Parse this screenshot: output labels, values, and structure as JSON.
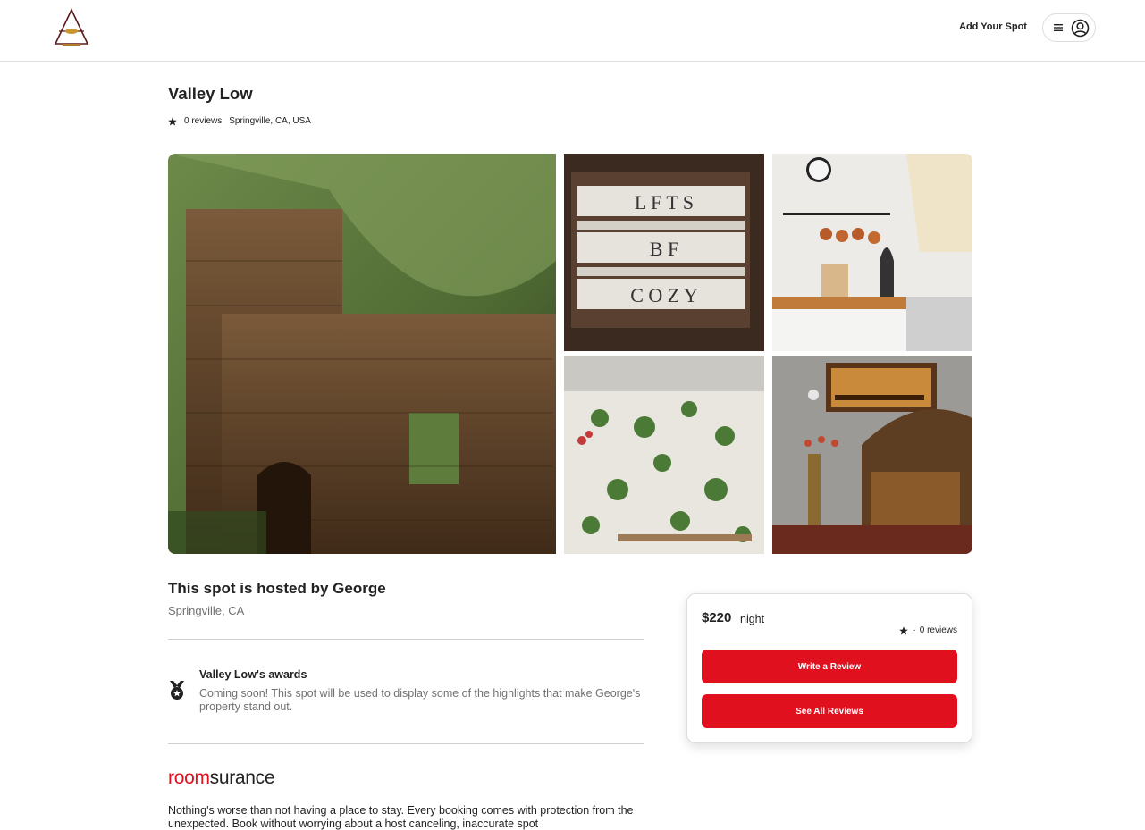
{
  "header": {
    "logo_icon": "triangle-lamp-logo",
    "add_spot_label": "Add Your Spot",
    "menu_icon": "hamburger-menu-icon",
    "profile_icon": "user-circle-icon"
  },
  "spot": {
    "title": "Valley Low",
    "reviews_label": "0 reviews",
    "location": "Springville, CA, USA"
  },
  "gallery": {
    "images": [
      {
        "icon": "stone-ruin-photo",
        "alt": "Stone ruins on a green hillside"
      },
      {
        "icon": "letter-board-photo",
        "alt": "Letter board"
      },
      {
        "icon": "kitchen-photo",
        "alt": "Kitchen with copper pots"
      },
      {
        "icon": "plants-photo",
        "alt": "Room full of hanging plants"
      },
      {
        "icon": "armchair-photo",
        "alt": "Vintage armchair and painting"
      }
    ],
    "letter_board": [
      "L F T S",
      "B F",
      "C O Z Y"
    ]
  },
  "host": {
    "title": "This spot is hosted by George",
    "location": "Springville, CA"
  },
  "awards": {
    "icon": "medal-icon",
    "title": "Valley Low's awards",
    "text": "Coming soon! This spot will be used to display some of the highlights that make George's property stand out."
  },
  "roomsurance": {
    "logo_part1": "room",
    "logo_part2": "surance",
    "text": "Nothing's worse than not having a place to stay. Every booking comes with protection from the unexpected. Book without worrying about a host canceling, inaccurate spot"
  },
  "booking": {
    "price": "$220",
    "per": "night",
    "dot": "·",
    "reviews_label": "0 reviews",
    "write_review_label": "Write a Review",
    "see_reviews_label": "See All Reviews"
  },
  "colors": {
    "brand_red": "#e0101f",
    "text_primary": "#222222",
    "text_secondary": "#717171",
    "border": "#dddddd"
  }
}
